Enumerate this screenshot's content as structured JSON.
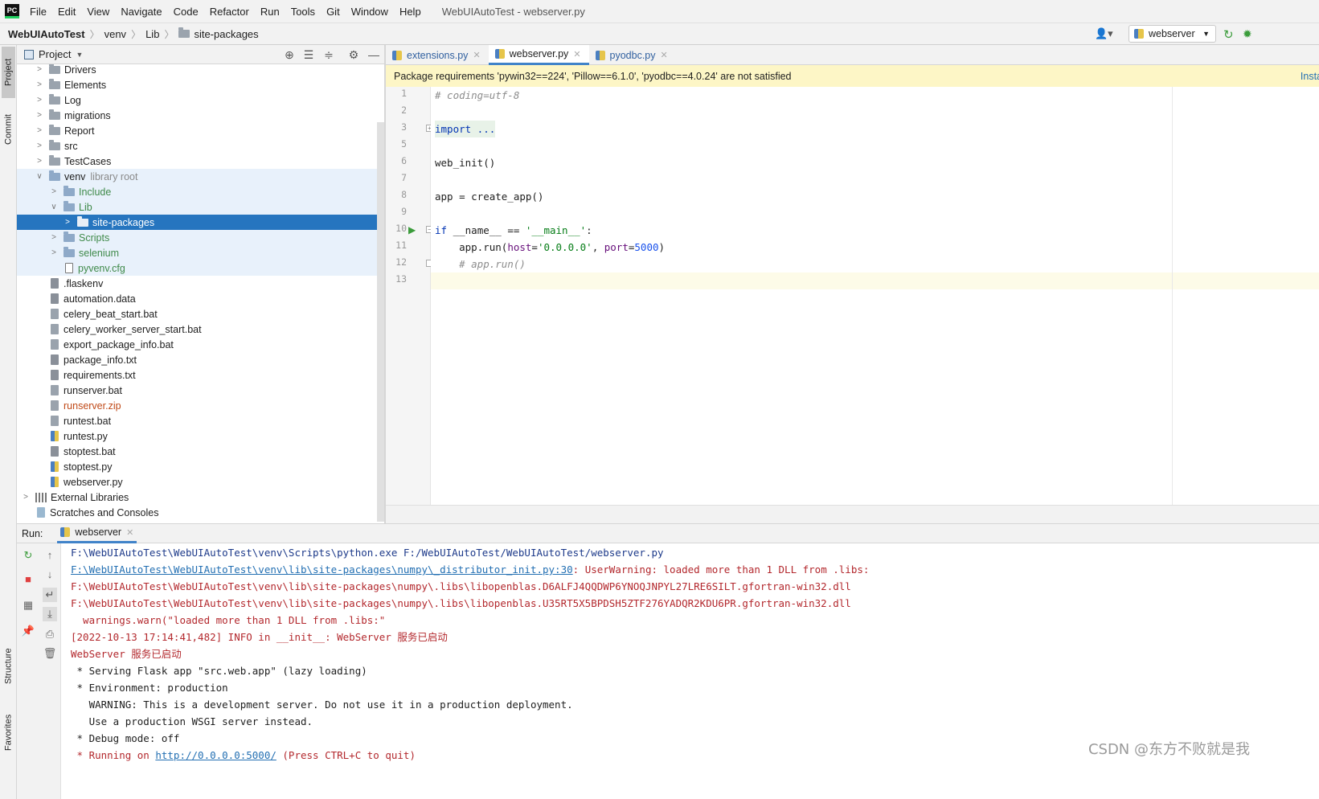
{
  "menu": {
    "logo": "PC",
    "items": [
      "File",
      "Edit",
      "View",
      "Navigate",
      "Code",
      "Refactor",
      "Run",
      "Tools",
      "Git",
      "Window",
      "Help"
    ],
    "window_title": "WebUIAutoTest - webserver.py"
  },
  "breadcrumb": [
    "WebUIAutoTest",
    "venv",
    "Lib",
    "site-packages"
  ],
  "run_config": "webserver",
  "left_strip": {
    "project": "Project",
    "commit": "Commit",
    "structure": "Structure",
    "favorites": "Favorites"
  },
  "project_panel": {
    "title": "Project"
  },
  "tree": [
    {
      "label": "Drivers",
      "type": "folder"
    },
    {
      "label": "Elements",
      "type": "folder"
    },
    {
      "label": "Log",
      "type": "folder"
    },
    {
      "label": "migrations",
      "type": "folder"
    },
    {
      "label": "Report",
      "type": "folder"
    },
    {
      "label": "src",
      "type": "folder"
    },
    {
      "label": "TestCases",
      "type": "folder"
    },
    {
      "label": "venv",
      "suffix": "library root",
      "type": "folder-open"
    },
    {
      "label": "Include",
      "type": "folder"
    },
    {
      "label": "Lib",
      "type": "folder-open"
    },
    {
      "label": "site-packages",
      "type": "folder",
      "selected": true
    },
    {
      "label": "Scripts",
      "type": "folder"
    },
    {
      "label": "selenium",
      "type": "folder"
    },
    {
      "label": "pyvenv.cfg",
      "type": "cfg"
    },
    {
      "label": ".flaskenv",
      "type": "file"
    },
    {
      "label": "automation.data",
      "type": "file"
    },
    {
      "label": "celery_beat_start.bat",
      "type": "bat"
    },
    {
      "label": "celery_worker_server_start.bat",
      "type": "bat"
    },
    {
      "label": "export_package_info.bat",
      "type": "bat"
    },
    {
      "label": "package_info.txt",
      "type": "file"
    },
    {
      "label": "requirements.txt",
      "type": "file"
    },
    {
      "label": "runserver.bat",
      "type": "bat"
    },
    {
      "label": "runserver.zip",
      "type": "zip"
    },
    {
      "label": "runtest.bat",
      "type": "bat"
    },
    {
      "label": "runtest.py",
      "type": "py"
    },
    {
      "label": "stoptest.bat",
      "type": "file"
    },
    {
      "label": "stoptest.py",
      "type": "py"
    },
    {
      "label": "webserver.py",
      "type": "py"
    },
    {
      "label": "External Libraries",
      "type": "lib"
    },
    {
      "label": "Scratches and Consoles",
      "type": "scratch"
    }
  ],
  "editor_tabs": [
    {
      "label": "extensions.py",
      "active": false
    },
    {
      "label": "webserver.py",
      "active": true
    },
    {
      "label": "pyodbc.py",
      "active": false
    }
  ],
  "banner": {
    "text": "Package requirements 'pywin32==224', 'Pillow==6.1.0', 'pyodbc==4.0.24' are not satisfied",
    "action": "Insta"
  },
  "line_numbers": [
    "1",
    "2",
    "3",
    "5",
    "6",
    "7",
    "8",
    "9",
    "10",
    "11",
    "12",
    "13"
  ],
  "code": {
    "l1": "# coding=utf-8",
    "l3": "import ...",
    "l6": "web_init()",
    "l8": "app = create_app()",
    "l10_kw": "if",
    "l10_a": " __name__ == ",
    "l10_s": "'__main__'",
    "l10_b": ":",
    "l11_a": "    app.run(",
    "l11_p1": "host",
    "l11_eq1": "=",
    "l11_s": "'0.0.0.0'",
    "l11_c": ", ",
    "l11_p2": "port",
    "l11_eq2": "=",
    "l11_n": "5000",
    "l11_e": ")",
    "l12": "    # app.run()"
  },
  "run_panel": {
    "label": "Run:",
    "tab": "webserver"
  },
  "console": {
    "c1": "F:\\WebUIAutoTest\\WebUIAutoTest\\venv\\Scripts\\python.exe F:/WebUIAutoTest/WebUIAutoTest/webserver.py",
    "c2_link": "F:\\WebUIAutoTest\\WebUIAutoTest\\venv\\lib\\site-packages\\numpy\\_distributor_init.py:30",
    "c2_rest": ": UserWarning: loaded more than 1 DLL from .libs:",
    "c3": "F:\\WebUIAutoTest\\WebUIAutoTest\\venv\\lib\\site-packages\\numpy\\.libs\\libopenblas.D6ALFJ4QQDWP6YNOQJNPYL27LRE6SILT.gfortran-win32.dll",
    "c4": "F:\\WebUIAutoTest\\WebUIAutoTest\\venv\\lib\\site-packages\\numpy\\.libs\\libopenblas.U35RT5X5BPDSH5ZTF276YADQR2KDU6PR.gfortran-win32.dll",
    "c5": "  warnings.warn(\"loaded more than 1 DLL from .libs:\"",
    "c6": "[2022-10-13 17:14:41,482] INFO in __init__: WebServer 服务已启动",
    "c7": "WebServer 服务已启动",
    "c8": " * Serving Flask app \"src.web.app\" (lazy loading)",
    "c9": " * Environment: production",
    "c10": "   WARNING: This is a development server. Do not use it in a production deployment.",
    "c11": "   Use a production WSGI server instead.",
    "c12": " * Debug mode: off",
    "c13_a": " * Running on ",
    "c13_link": "http://0.0.0.0:5000/",
    "c13_b": " (Press CTRL+C to quit)"
  },
  "watermark": "CSDN @东方不败就是我"
}
